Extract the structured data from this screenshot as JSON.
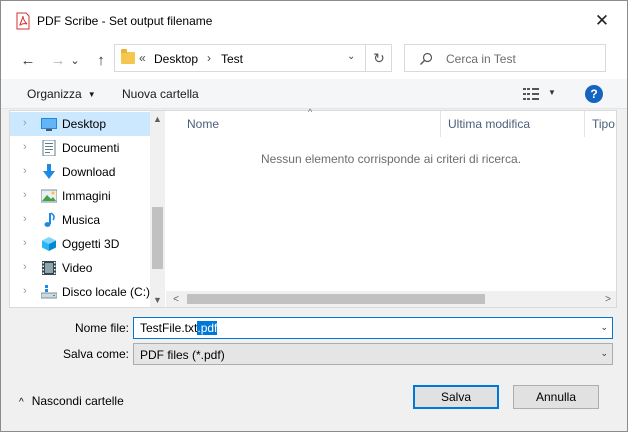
{
  "window": {
    "title": "PDF Scribe - Set output filename",
    "close_glyph": "✕"
  },
  "nav": {
    "back_glyph": "←",
    "forward_glyph": "→",
    "recent_glyph": "⌄",
    "up_glyph": "↑",
    "breadcrumb_overflow": "«",
    "breadcrumb": [
      "Desktop",
      "Test"
    ],
    "breadcrumb_sep": "›",
    "address_dropdown_glyph": "⌄",
    "refresh_glyph": "↻",
    "search_placeholder": "Cerca in Test"
  },
  "toolbar": {
    "organize_label": "Organizza",
    "new_folder_label": "Nuova cartella",
    "caret_glyph": "▼",
    "help_glyph": "?"
  },
  "sidebar": {
    "items": [
      {
        "label": "Desktop",
        "icon": "desktop-icon",
        "selected": true
      },
      {
        "label": "Documenti",
        "icon": "documents-icon",
        "selected": false
      },
      {
        "label": "Download",
        "icon": "download-icon",
        "selected": false
      },
      {
        "label": "Immagini",
        "icon": "pictures-icon",
        "selected": false
      },
      {
        "label": "Musica",
        "icon": "music-icon",
        "selected": false
      },
      {
        "label": "Oggetti 3D",
        "icon": "objects-3d-icon",
        "selected": false
      },
      {
        "label": "Video",
        "icon": "video-icon",
        "selected": false
      },
      {
        "label": "Disco locale (C:)",
        "icon": "local-disk-icon",
        "selected": false
      }
    ],
    "chevron_glyph": "›",
    "scroll_up_glyph": "▲",
    "scroll_down_glyph": "▼"
  },
  "filelist": {
    "columns": [
      "Nome",
      "Ultima modifica",
      "Tipo"
    ],
    "sort_glyph": "^",
    "empty_message": "Nessun elemento corrisponde ai criteri di ricerca.",
    "scroll_left_glyph": "<",
    "scroll_right_glyph": ">"
  },
  "form": {
    "filename_label": "Nome file:",
    "filename_base": "TestFile.txt",
    "filename_selected": ".pdf",
    "filetype_label": "Salva come:",
    "filetype_value": "PDF files (*.pdf)",
    "combo_glyph": "⌄"
  },
  "footer": {
    "hide_folders_label": "Nascondi cartelle",
    "hide_folders_glyph": "^",
    "save_label": "Salva",
    "cancel_label": "Annulla"
  },
  "colors": {
    "accent": "#0078d7",
    "selection": "#cce8ff",
    "help": "#1565c0",
    "app_icon": "#d32f2f"
  }
}
